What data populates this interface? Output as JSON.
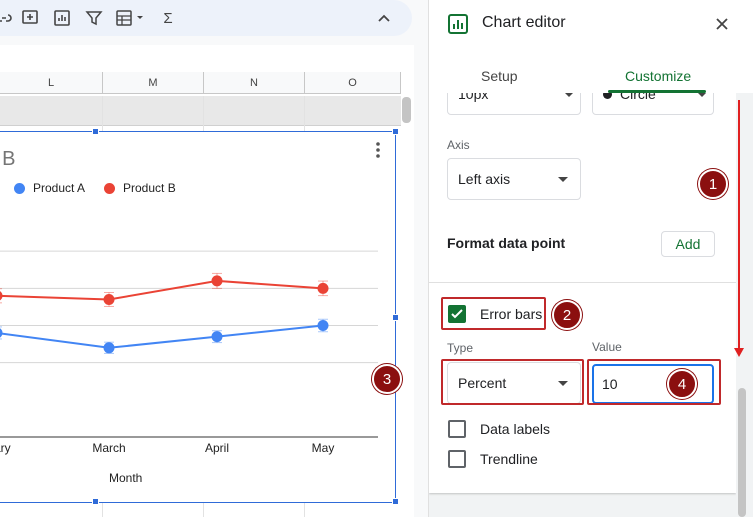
{
  "colors": {
    "accent_green": "#137333",
    "series_a": "#4285f4",
    "series_b": "#ea4335",
    "annotation_red": "#c0292b",
    "badge": "#8b0f0f",
    "selection_blue": "#2f6bd8"
  },
  "toolbar": {
    "icons": [
      "link-icon",
      "insert-comment-icon",
      "insert-chart-icon",
      "filter-icon",
      "filter-views-icon",
      "functions-icon",
      "collapse-icon"
    ],
    "functions_glyph": "Σ"
  },
  "sheet": {
    "columns": [
      "L",
      "M",
      "N",
      "O"
    ]
  },
  "chart": {
    "title_fragment": "ct B",
    "legend": [
      "Product A",
      "Product B"
    ],
    "x_ticks": [
      "ruary",
      "March",
      "April",
      "May"
    ],
    "x_axis_label": "Month"
  },
  "chart_data": {
    "type": "line",
    "categories": [
      "February",
      "March",
      "April",
      "May"
    ],
    "series": [
      {
        "name": "Product A",
        "values": [
          58,
          54,
          57,
          60
        ]
      },
      {
        "name": "Product B",
        "values": [
          68,
          67,
          72,
          70
        ]
      }
    ],
    "error_bars": {
      "type": "Percent",
      "value": 10
    },
    "ylim": [
      30,
      90
    ],
    "grid": true,
    "legend_position": "top-left"
  },
  "editor": {
    "title": "Chart editor",
    "tabs": [
      "Setup",
      "Customize"
    ],
    "active_tab": "Customize",
    "point_size_value": "10px",
    "point_shape_value": "Circle",
    "axis_label": "Axis",
    "axis_value": "Left axis",
    "format_data_point_label": "Format data point",
    "add_button": "Add",
    "error_bars_label": "Error bars",
    "error_bars_checked": true,
    "type_label": "Type",
    "type_value": "Percent",
    "value_label": "Value",
    "value_input": "10",
    "data_labels_label": "Data labels",
    "trendline_label": "Trendline"
  },
  "annotations": [
    "1",
    "2",
    "3",
    "4"
  ]
}
